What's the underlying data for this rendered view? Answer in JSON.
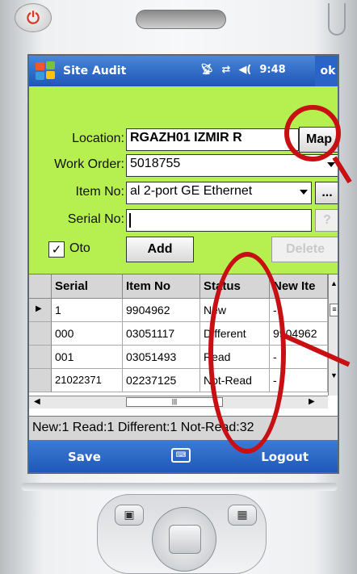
{
  "app": {
    "title": "Site Audit",
    "clock": "9:48",
    "ok_label": "ok",
    "status_icons": [
      "signal-antenna-icon",
      "connectivity-arrows-icon",
      "speaker-volume-icon"
    ]
  },
  "form": {
    "location": {
      "label": "Location:",
      "value": "RGAZH01 IZMIR R"
    },
    "map_button": "Map",
    "work_order": {
      "label": "Work Order:",
      "value": "5018755"
    },
    "item_no": {
      "label": "Item No:",
      "value": "al 2-port GE Ethernet"
    },
    "item_more_button": "...",
    "serial_no": {
      "label": "Serial No:",
      "value": ""
    },
    "help_button": "?",
    "oto": {
      "label": "Oto",
      "checked": true
    },
    "add_button": "Add",
    "delete_button": "Delete"
  },
  "grid": {
    "columns": [
      "Serial",
      "Item No",
      "Status",
      "New Ite"
    ],
    "rows": [
      {
        "serial": "1",
        "item_no": "9904962",
        "status": "New",
        "new_item": "-"
      },
      {
        "serial": "000",
        "item_no": "03051117",
        "status": "Different",
        "new_item": "9904962"
      },
      {
        "serial": "001",
        "item_no": "03051493",
        "status": "Read",
        "new_item": "-"
      },
      {
        "serial": "21022371",
        "item_no": "02237125",
        "status": "Not-Read",
        "new_item": "-"
      }
    ]
  },
  "summary": "New:1 Read:1 Different:1 Not-Read:32",
  "menu": {
    "left": "Save",
    "right": "Logout"
  },
  "colors": {
    "form_bg": "#b6ef50",
    "titlebar": "#1e56b6",
    "annotation_red": "#c80f14"
  }
}
